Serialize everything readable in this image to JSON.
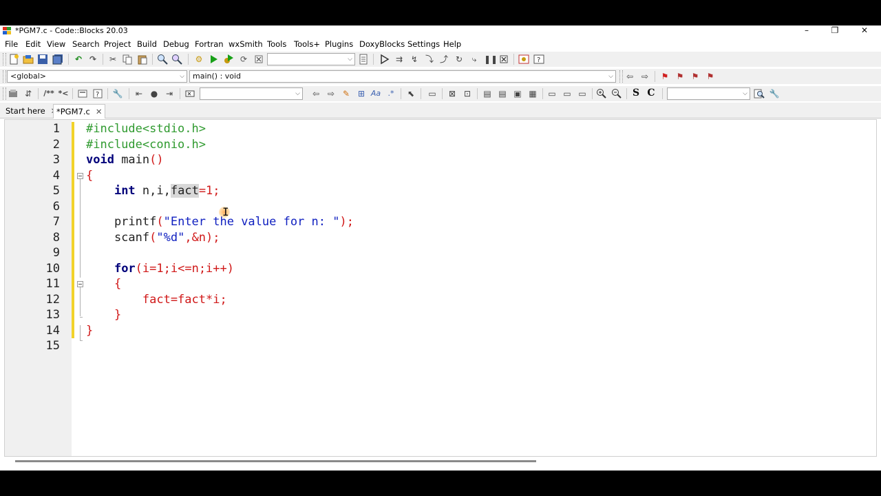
{
  "window": {
    "title": "*PGM7.c - Code::Blocks 20.03",
    "minimize": "–",
    "maximize": "❐",
    "close": "✕"
  },
  "menu": [
    "File",
    "Edit",
    "View",
    "Search",
    "Project",
    "Build",
    "Debug",
    "Fortran",
    "wxSmith",
    "Tools",
    "Tools+",
    "Plugins",
    "DoxyBlocks",
    "Settings",
    "Help"
  ],
  "toolbar": {
    "scope_combo": "<global>",
    "function_combo": "main() : void",
    "search_combo": "",
    "target_combo": "",
    "doc_icon_c": "C",
    "doc_icon_s": "S",
    "doc_icon_comment": "/**",
    "doc_icon_line": "*<"
  },
  "tabs": [
    {
      "label": "Start here",
      "close": "✕"
    },
    {
      "label": "*PGM7.c",
      "close": "✕"
    }
  ],
  "editor": {
    "line_numbers": [
      "1",
      "2",
      "3",
      "4",
      "5",
      "6",
      "7",
      "8",
      "9",
      "10",
      "11",
      "12",
      "13",
      "14",
      "15"
    ],
    "lines": [
      [
        "#include<stdio.h>"
      ],
      [
        "#include<conio.h>"
      ],
      [
        "void",
        " main",
        "()"
      ],
      [
        "{"
      ],
      [
        "    ",
        "int",
        " n,i,",
        "fact",
        "=1",
        ";"
      ],
      [
        ""
      ],
      [
        "    printf",
        "(",
        "\"Enter the value for n: \"",
        ");"
      ],
      [
        "    scanf",
        "(",
        "\"%d\"",
        ",&n);"
      ],
      [
        ""
      ],
      [
        "    ",
        "for",
        "(i=",
        "1",
        ";i<=n;i++)"
      ],
      [
        "    ",
        "{"
      ],
      [
        "        fact=fact*i;"
      ],
      [
        "    ",
        "}"
      ],
      [
        "}"
      ],
      [
        ""
      ]
    ]
  },
  "colors": {
    "preprocessor": "#2f9a2f",
    "keyword": "#00007a",
    "punctuation": "#d01818",
    "string": "#1020c0",
    "change_bar": "#f2d22a"
  }
}
